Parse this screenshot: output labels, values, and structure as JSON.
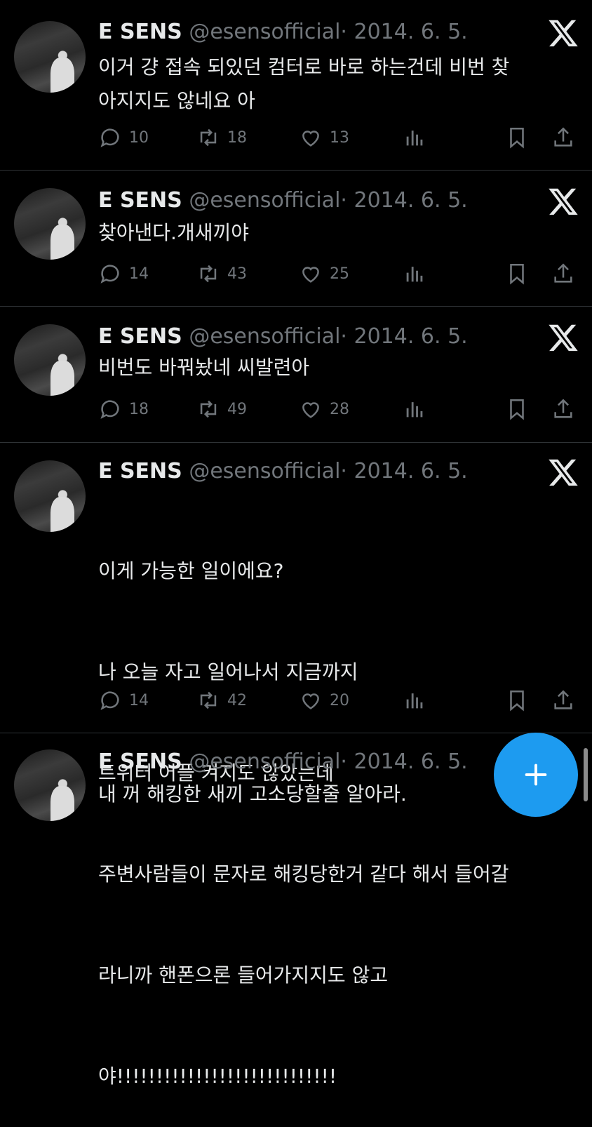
{
  "colors": {
    "background": "#000000",
    "text": "#e7e9ea",
    "muted": "#71767b",
    "accent": "#1d9bf0"
  },
  "tweets": [
    {
      "name": "E SENS",
      "handle": "@esensofficial",
      "dot": "·",
      "date": "2014. 6. 5.",
      "lines": [
        "이거 걍 접속 되있던 컴터로 바로 하는건데 비번 찾",
        "아지지도 않네요 아"
      ],
      "replies": "10",
      "retweets": "18",
      "likes": "13"
    },
    {
      "name": "E SENS",
      "handle": "@esensofficial",
      "dot": "·",
      "date": "2014. 6. 5.",
      "lines": [
        "찾아낸다.개새끼야"
      ],
      "replies": "14",
      "retweets": "43",
      "likes": "25"
    },
    {
      "name": "E SENS",
      "handle": "@esensofficial",
      "dot": "·",
      "date": "2014. 6. 5.",
      "lines": [
        "비번도 바꿔놨네 씨발련아"
      ],
      "replies": "18",
      "retweets": "49",
      "likes": "28"
    },
    {
      "name": "E SENS",
      "handle": "@esensofficial",
      "dot": "·",
      "date": "2014. 6. 5.",
      "lines": [
        "이게 가능한 일이에요?",
        "나 오늘 자고 일어나서 지금까지",
        "트위터 어플 켜지도 않았는데",
        "주변사람들이 문자로 해킹당한거 같다 해서 들어갈",
        "라니까 핸폰으론 들어가지지도 않고",
        "야!!!!!!!!!!!!!!!!!!!!!!!!!!!!"
      ],
      "replies": "14",
      "retweets": "42",
      "likes": "20"
    },
    {
      "name": "E SENS",
      "handle": "@esensofficial",
      "dot": "·",
      "date": "2014. 6. 5.",
      "lines": [
        "내 꺼 해킹한 새끼 고소당할줄 알아라."
      ]
    }
  ],
  "icons": {
    "reply": "reply-icon",
    "retweet": "retweet-icon",
    "like": "heart-icon",
    "views": "views-icon",
    "bookmark": "bookmark-icon",
    "share": "share-icon",
    "logo": "x-logo-icon",
    "compose": "plus-icon"
  }
}
